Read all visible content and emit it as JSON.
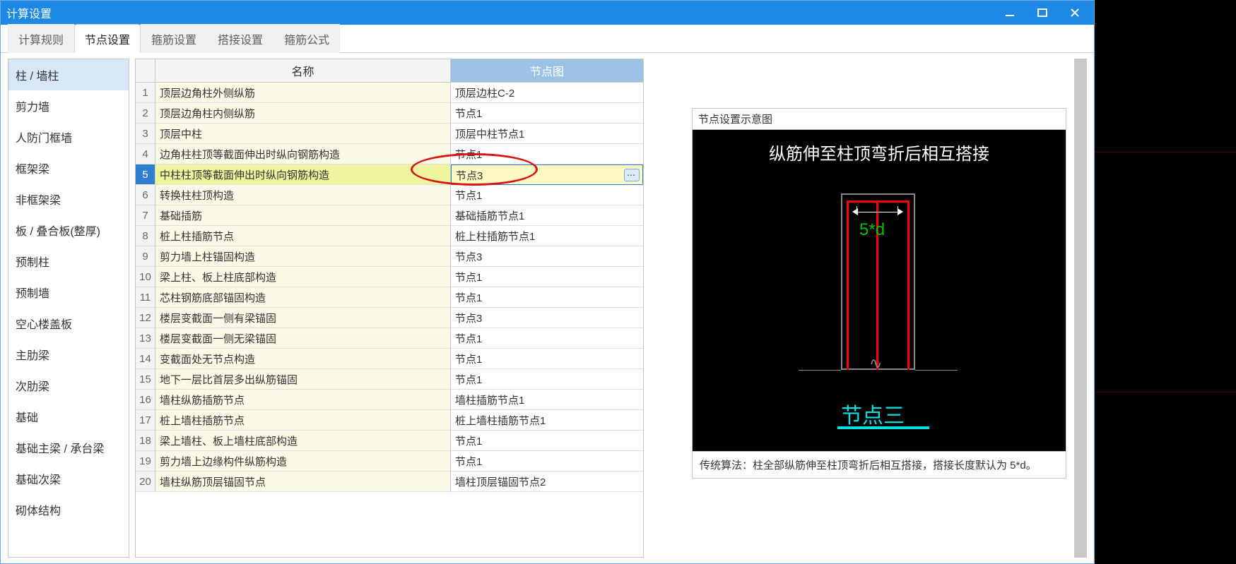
{
  "window": {
    "title": "计算设置"
  },
  "tabs": [
    {
      "label": "计算规则",
      "active": false
    },
    {
      "label": "节点设置",
      "active": true
    },
    {
      "label": "箍筋设置",
      "active": false
    },
    {
      "label": "搭接设置",
      "active": false
    },
    {
      "label": "箍筋公式",
      "active": false
    }
  ],
  "sidebar": {
    "items": [
      "柱 / 墙柱",
      "剪力墙",
      "人防门框墙",
      "框架梁",
      "非框架梁",
      "板 / 叠合板(整厚)",
      "预制柱",
      "预制墙",
      "空心楼盖板",
      "主肋梁",
      "次肋梁",
      "基础",
      "基础主梁 / 承台梁",
      "基础次梁",
      "砌体结构"
    ],
    "activeIndex": 0
  },
  "grid": {
    "headers": {
      "name": "名称",
      "value": "节点图"
    },
    "selectedIndex": 4,
    "rows": [
      {
        "name": "顶层边角柱外侧纵筋",
        "value": "顶层边柱C-2"
      },
      {
        "name": "顶层边角柱内侧纵筋",
        "value": "节点1"
      },
      {
        "name": "顶层中柱",
        "value": "顶层中柱节点1"
      },
      {
        "name": "边角柱柱顶等截面伸出时纵向钢筋构造",
        "value": "节点1"
      },
      {
        "name": "中柱柱顶等截面伸出时纵向钢筋构造",
        "value": "节点3"
      },
      {
        "name": "转换柱柱顶构造",
        "value": "节点1"
      },
      {
        "name": "基础插筋",
        "value": "基础插筋节点1"
      },
      {
        "name": "桩上柱插筋节点",
        "value": "桩上柱插筋节点1"
      },
      {
        "name": "剪力墙上柱锚固构造",
        "value": "节点3"
      },
      {
        "name": "梁上柱、板上柱底部构造",
        "value": "节点1"
      },
      {
        "name": "芯柱钢筋底部锚固构造",
        "value": "节点1"
      },
      {
        "name": "楼层变截面一侧有梁锚固",
        "value": "节点3"
      },
      {
        "name": "楼层变截面一侧无梁锚固",
        "value": "节点1"
      },
      {
        "name": "变截面处无节点构造",
        "value": "节点1"
      },
      {
        "name": "地下一层比首层多出纵筋锚固",
        "value": "节点1"
      },
      {
        "name": "墙柱纵筋插筋节点",
        "value": "墙柱插筋节点1"
      },
      {
        "name": "桩上墙柱插筋节点",
        "value": "桩上墙柱插筋节点1"
      },
      {
        "name": "梁上墙柱、板上墙柱底部构造",
        "value": "节点1"
      },
      {
        "name": "剪力墙上边缘构件纵筋构造",
        "value": "节点1"
      },
      {
        "name": "墙柱纵筋顶层锚固节点",
        "value": "墙柱顶层锚固节点2"
      }
    ]
  },
  "diagram": {
    "panel_title": "节点设置示意图",
    "heading": "纵筋伸至柱顶弯折后相互搭接",
    "dim_label": "5*d",
    "node_label": "节点三",
    "caption": "传统算法：柱全部纵筋伸至柱顶弯折后相互搭接，搭接长度默认为 5*d。"
  }
}
